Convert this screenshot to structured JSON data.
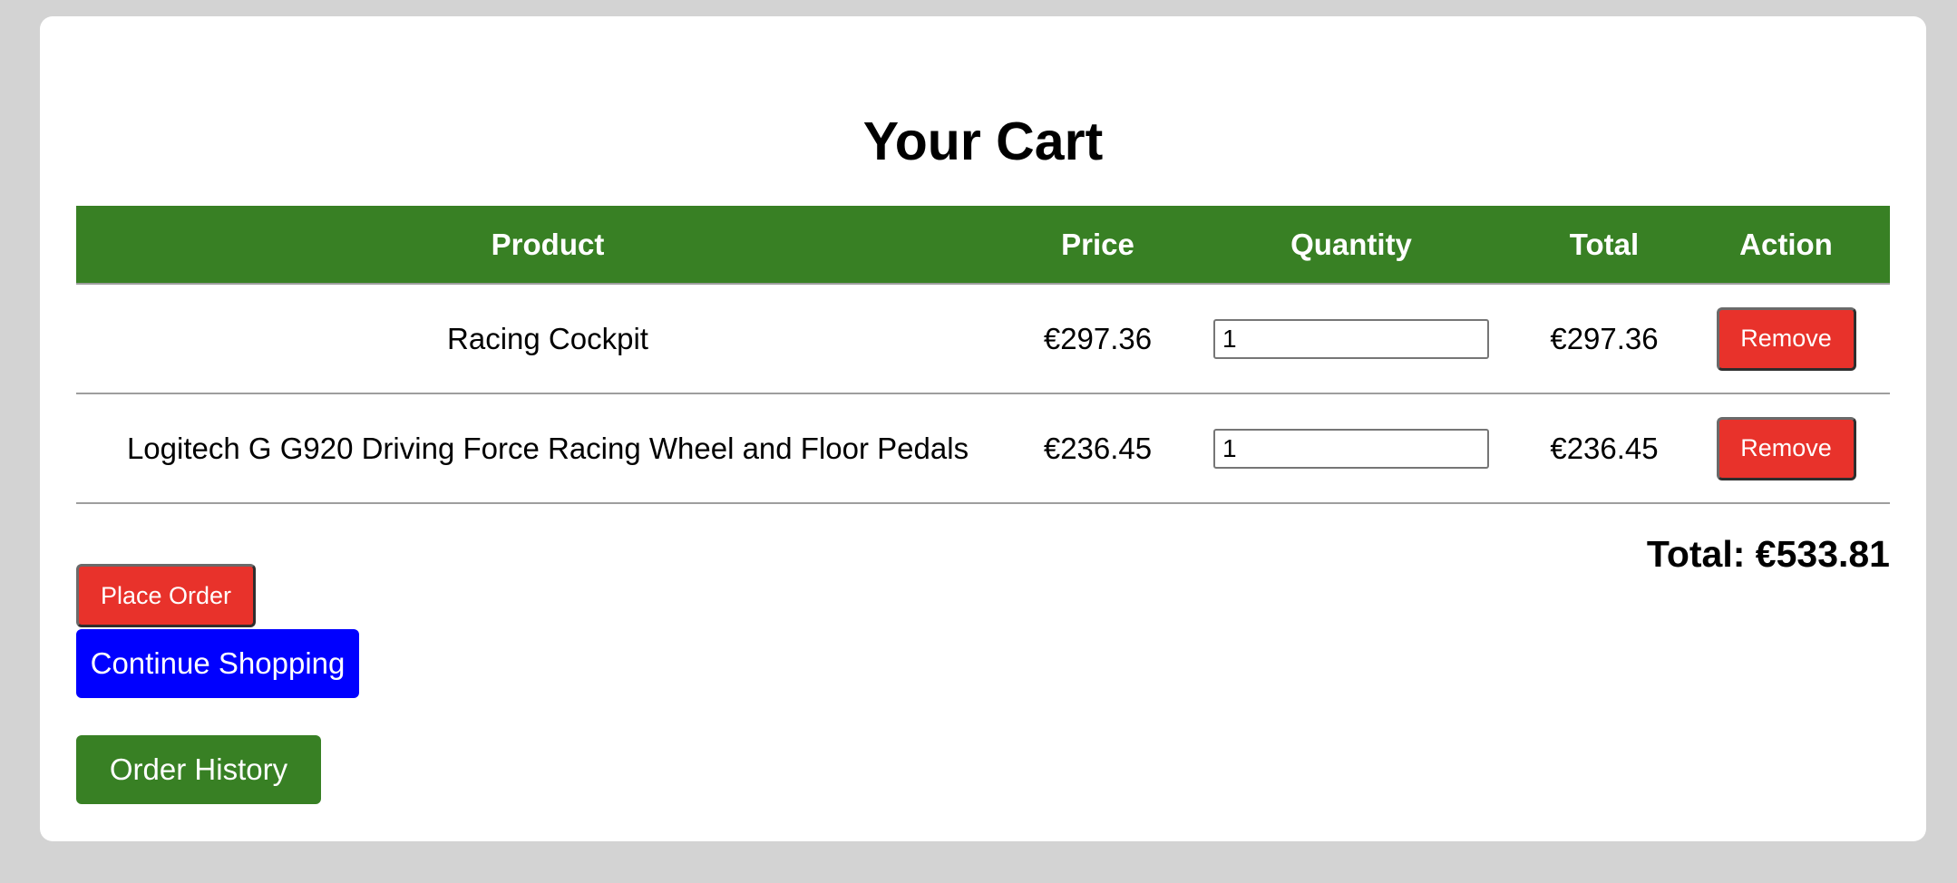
{
  "page": {
    "title": "Your Cart"
  },
  "table": {
    "headers": {
      "product": "Product",
      "price": "Price",
      "quantity": "Quantity",
      "total": "Total",
      "action": "Action"
    },
    "rows": [
      {
        "product": "Racing Cockpit",
        "price": "€297.36",
        "quantity": "1",
        "total": "€297.36",
        "action_label": "Remove"
      },
      {
        "product": "Logitech G G920 Driving Force Racing Wheel and Floor Pedals",
        "price": "€236.45",
        "quantity": "1",
        "total": "€236.45",
        "action_label": "Remove"
      }
    ]
  },
  "summary": {
    "total_text": "Total: €533.81"
  },
  "actions": {
    "place_order": "Place Order",
    "continue_shopping": "Continue Shopping",
    "order_history": "Order History"
  },
  "colors": {
    "header_bg": "#388024",
    "remove_button": "#e8322b",
    "continue_button": "#0000ff",
    "history_button": "#388024",
    "page_bg": "#d3d3d3"
  }
}
